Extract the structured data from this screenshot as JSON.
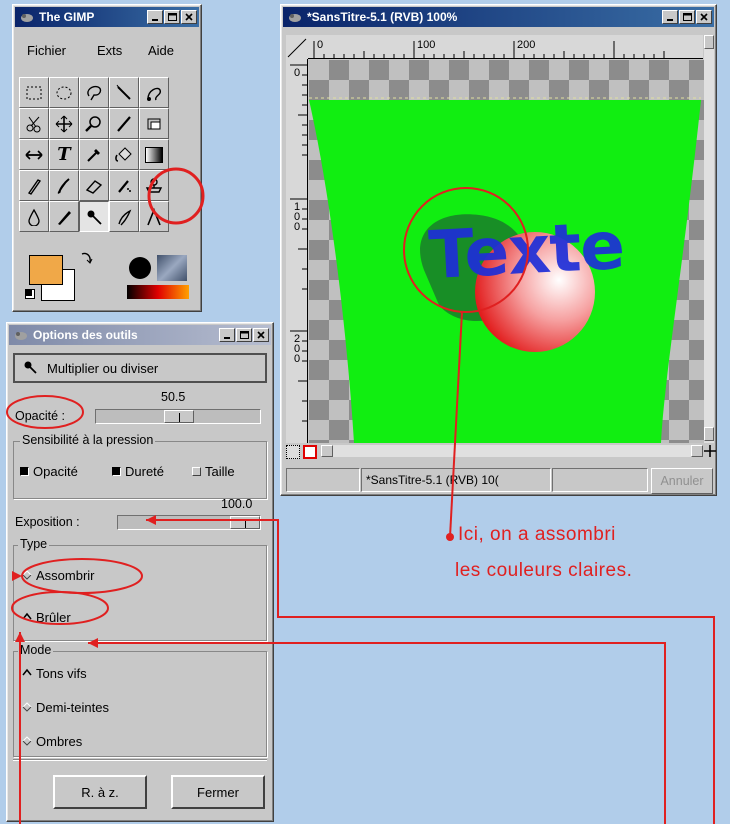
{
  "toolbox": {
    "title": "The GIMP",
    "menu": [
      "Fichier",
      "Exts",
      "Aide"
    ]
  },
  "image_window": {
    "title": "*SansTitre-5.1 (RVB) 100%",
    "ruler_top": [
      "0",
      "100",
      "200"
    ],
    "ruler_left": [
      "0",
      "100",
      "200"
    ],
    "canvas_text": "Texte",
    "status": "*SansTitre-5.1 (RVB) 10(",
    "cancel_label": "Annuler"
  },
  "tool_options": {
    "title": "Options des outils",
    "tool_name": "Multiplier ou diviser",
    "opacity_value": "50.5",
    "opacity_label": "Opacité :",
    "opacity_fraction": 0.505,
    "pressure_group": "Sensibilité à la pression",
    "pressure_opacity": "Opacité",
    "pressure_hardness": "Dureté",
    "pressure_size": "Taille",
    "exposure_value": "100.0",
    "exposure_label": "Exposition :",
    "type_group": "Type",
    "type_darken": "Assombrir",
    "type_burn": "Brûler",
    "mode_group": "Mode",
    "mode_highlights": "Tons vifs",
    "mode_midtones": "Demi-teintes",
    "mode_shadows": "Ombres",
    "reset_label": "R. à z.",
    "close_label": "Fermer"
  },
  "annotation": {
    "line1": "Ici, on a assombri",
    "line2": "les couleurs claires."
  },
  "colors": {
    "foreground": "#f0a848",
    "background": "#ffffff",
    "canvas_green": "#11ee11",
    "annotation_red": "#e02020"
  }
}
